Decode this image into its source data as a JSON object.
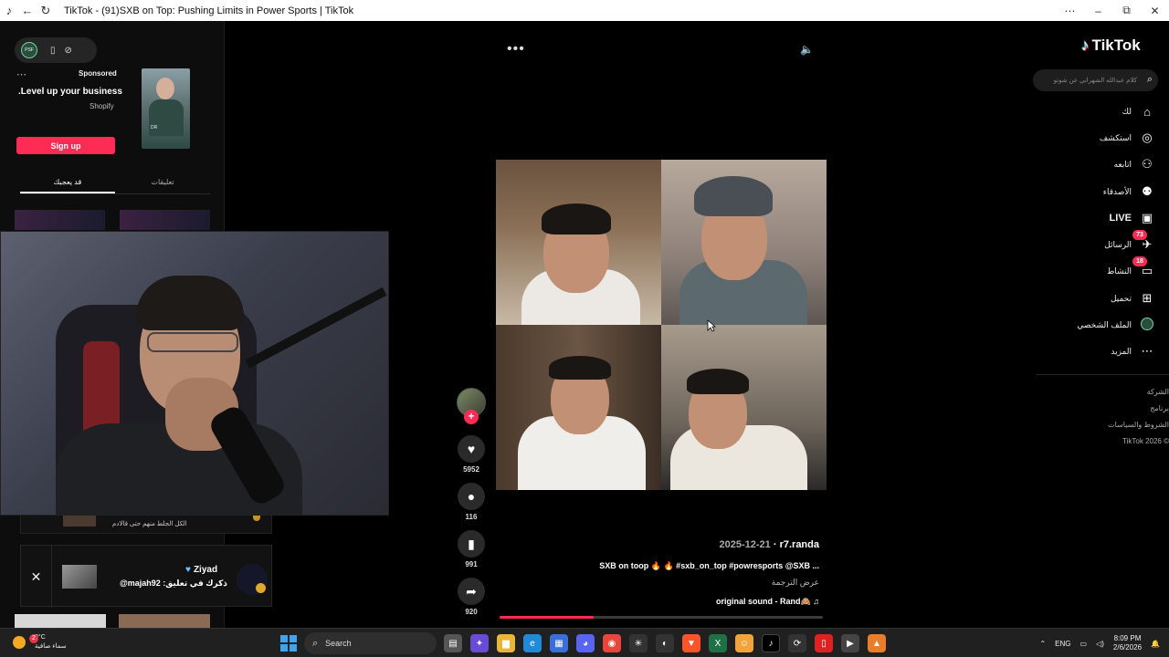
{
  "browser": {
    "title": "TikTok - (91)SXB on Top: Pushing Limits in Power Sports | TikTok",
    "window_controls": [
      "⋯",
      "–",
      "⧉",
      "✕"
    ]
  },
  "left": {
    "ad": {
      "sponsored": "Sponsored",
      "title": "Level up your business.",
      "brand": "Shopify",
      "signup": "Sign up",
      "thumb_caption": "DR"
    },
    "tabs": [
      "تعليقات",
      "قد يعجبك"
    ],
    "comment_strip_text": "الكل الجلط منهم حتى قالادم",
    "notification": {
      "name": "Ziyad",
      "text": "ذكرك في تعليق: majah92@"
    }
  },
  "video": {
    "actions": [
      {
        "name": "like",
        "icon": "♥",
        "count": "5952"
      },
      {
        "name": "comment",
        "icon": "●",
        "count": "116"
      },
      {
        "name": "save",
        "icon": "▮",
        "count": "991"
      },
      {
        "name": "share",
        "icon": "➦",
        "count": "920"
      }
    ],
    "author": "r7.randa",
    "date": "2025-12-21",
    "description": "SXB on toop 🔥 🔥 #sxb_on_top #powresports @SXB ...",
    "translate": "عرض الترجمة",
    "sound": "original sound - Rand🙈",
    "progress": 0.29
  },
  "right": {
    "logo": "TikTok",
    "search_placeholder": "كلام عبدالله الشهراني عن شوتو",
    "nav": [
      {
        "label": "لك",
        "icon": "⌂",
        "name": "home"
      },
      {
        "label": "استكشف",
        "icon": "◎",
        "name": "explore"
      },
      {
        "label": "اتابعه",
        "icon": "⚇",
        "name": "following"
      },
      {
        "label": "الأصدقاء",
        "icon": "⚉",
        "name": "friends"
      },
      {
        "label": "LIVE",
        "icon": "▣",
        "name": "live"
      },
      {
        "label": "الرسائل",
        "icon": "✈",
        "name": "messages",
        "badge": "73"
      },
      {
        "label": "النشاط",
        "icon": "▭",
        "name": "activity",
        "badge": "18"
      },
      {
        "label": "تحميل",
        "icon": "⊞",
        "name": "upload"
      },
      {
        "label": "الملف الشخصي",
        "icon": "",
        "name": "profile"
      },
      {
        "label": "المزيد",
        "icon": "⋯",
        "name": "more"
      }
    ],
    "footer": [
      "الشركة",
      "برنامج",
      "الشروط والسياسات",
      "TikTok 2026 ©"
    ]
  },
  "taskbar": {
    "temp": "9°C",
    "weather": "سماء صافية",
    "weather_badge": "2",
    "search": "Search",
    "lang": "ENG",
    "time": "8:09 PM",
    "date": "2/6/2026"
  }
}
